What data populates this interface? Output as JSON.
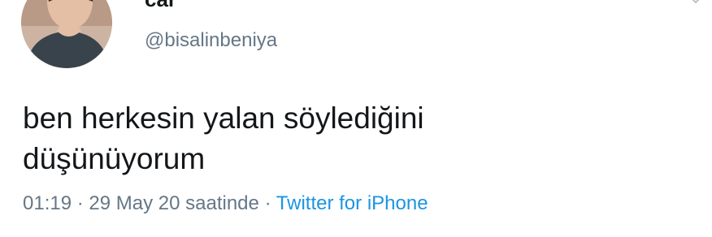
{
  "tweet": {
    "author": {
      "display_name": "car",
      "handle": "@bisalinbeniya"
    },
    "text_lines": [
      "ben herkesin yalan söylediğini",
      "düşünüyorum"
    ],
    "time": "01:19",
    "separator": "·",
    "date": "29 May 20 saatinde",
    "source": "Twitter for iPhone"
  },
  "colors": {
    "text": "#14171a",
    "muted": "#657786",
    "link": "#1b95e0"
  },
  "icons": {
    "more": "chevron-down-icon"
  }
}
